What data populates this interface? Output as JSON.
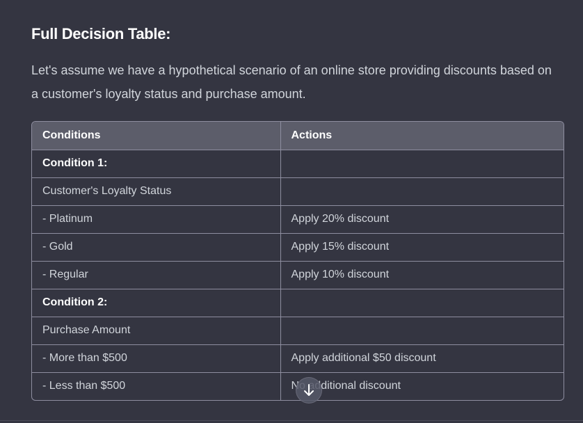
{
  "heading": "Full Decision Table:",
  "paragraph": "Let's assume we have a hypothetical scenario of an online store providing discounts based on a customer's loyalty status and purchase amount.",
  "table": {
    "headers": [
      "Conditions",
      "Actions"
    ],
    "rows": [
      {
        "condition": "Condition 1:",
        "action": ""
      },
      {
        "condition": "Customer's Loyalty Status",
        "action": ""
      },
      {
        "condition": "- Platinum",
        "action": "Apply 20% discount"
      },
      {
        "condition": "- Gold",
        "action": "Apply 15% discount"
      },
      {
        "condition": "- Regular",
        "action": "Apply 10% discount"
      },
      {
        "condition": "Condition 2:",
        "action": ""
      },
      {
        "condition": "Purchase Amount",
        "action": ""
      },
      {
        "condition": "- More than $500",
        "action": "Apply additional $50 discount"
      },
      {
        "condition": "- Less than $500",
        "action": "No additional discount"
      }
    ]
  },
  "scroll_button": {
    "icon": "arrow-down-icon"
  }
}
